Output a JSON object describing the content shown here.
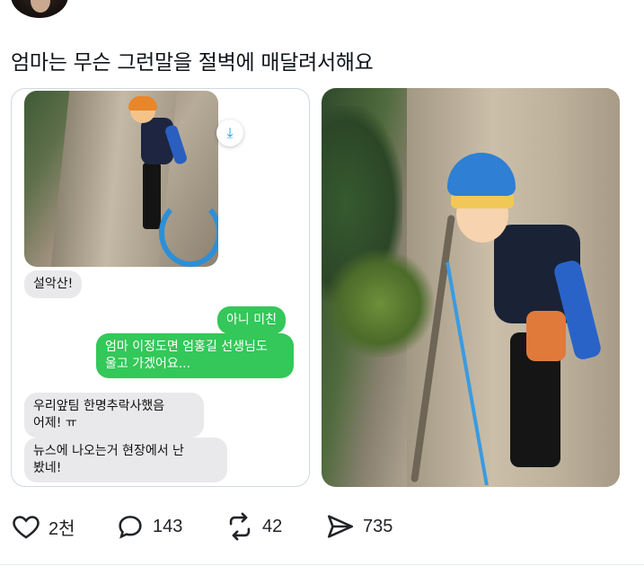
{
  "tweet": {
    "text": "엄마는 무슨 그런말을 절벽에 매달려서해요"
  },
  "chat": {
    "messages": [
      {
        "direction": "in",
        "text": "설악산!"
      },
      {
        "direction": "out",
        "text": "아니 미친"
      },
      {
        "direction": "out",
        "text": "엄마 이정도면 엄홍길 선생님도\n울고 가겠어요..."
      },
      {
        "direction": "in",
        "text": "우리앞팀 한명추락사했음\n어제! ㅠ"
      },
      {
        "direction": "in",
        "text": "뉴스에 나오는거 현장에서 난\n봤네!"
      }
    ]
  },
  "actions": {
    "likes": "2천",
    "replies": "143",
    "retweets": "42",
    "views": "735"
  },
  "icons": {
    "download": "download-icon",
    "like": "heart-icon",
    "reply": "reply-icon",
    "retweet": "retweet-icon",
    "share": "share-icon"
  },
  "colors": {
    "sent_bubble": "#34c759",
    "received_bubble": "#e9e9eb",
    "accent": "#1d9bf0"
  }
}
